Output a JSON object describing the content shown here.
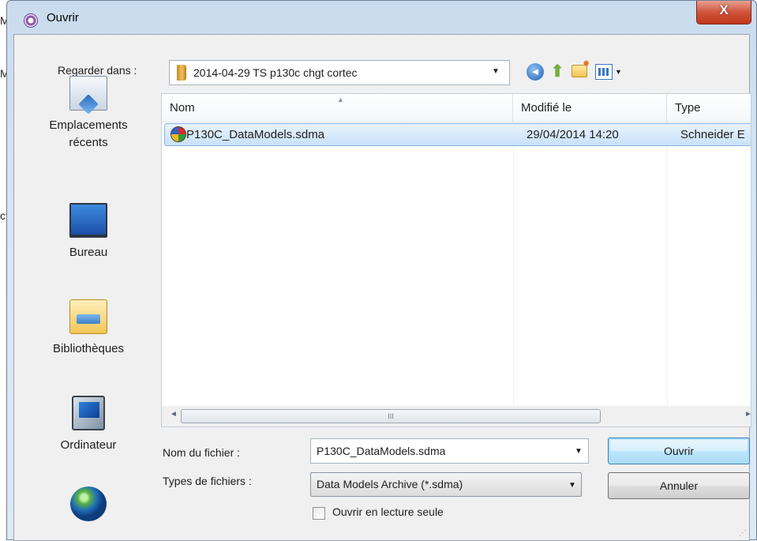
{
  "background_app": {
    "edge_letters": [
      "M",
      "M",
      "ct"
    ]
  },
  "window": {
    "title": "Ouvrir",
    "close_glyph": "X"
  },
  "toolbar": {
    "look_in_label": "Regarder dans :",
    "look_in_value": "2014-04-29 TS p130c chgt cortec",
    "icons": [
      "back-icon",
      "up-folder-icon",
      "new-folder-icon",
      "views-menu-icon"
    ]
  },
  "places": [
    {
      "label": "Emplacements récents",
      "icon": "recent-places-icon"
    },
    {
      "label": "Bureau",
      "icon": "desktop-icon"
    },
    {
      "label": "Bibliothèques",
      "icon": "libraries-icon"
    },
    {
      "label": "Ordinateur",
      "icon": "computer-icon"
    },
    {
      "label": "",
      "icon": "network-icon"
    }
  ],
  "file_list": {
    "columns": {
      "name": "Nom",
      "modified": "Modifié le",
      "type": "Type"
    },
    "rows": [
      {
        "name": "P130C_DataModels.sdma",
        "modified": "29/04/2014 14:20",
        "type": "Schneider E",
        "selected": true
      }
    ],
    "scroll_grip": "III"
  },
  "form": {
    "filename_label": "Nom du fichier :",
    "filename_value": "P130C_DataModels.sdma",
    "filetype_label": "Types de fichiers :",
    "filetype_value": "Data Models Archive (*.sdma)",
    "readonly_label": "Ouvrir en lecture seule",
    "readonly_checked": false
  },
  "buttons": {
    "open": "Ouvrir",
    "cancel": "Annuler"
  },
  "colors": {
    "selection": "#cce4f7",
    "close_button": "#c7402b",
    "frame": "#d8e6f4",
    "accent": "#3c7fb1"
  }
}
